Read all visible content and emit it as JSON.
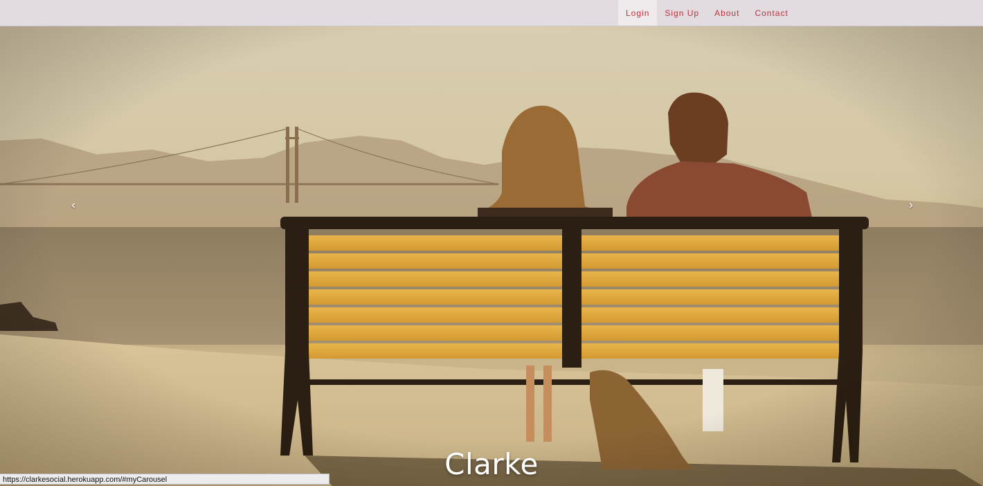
{
  "nav": {
    "items": [
      {
        "label": "Login",
        "active": true
      },
      {
        "label": "Sign Up",
        "active": false
      },
      {
        "label": "About",
        "active": false
      },
      {
        "label": "Contact",
        "active": false
      }
    ]
  },
  "carousel": {
    "prev_icon": "chevron-left-icon",
    "next_icon": "chevron-right-icon",
    "prev_glyph": "‹",
    "next_glyph": "›",
    "caption": "Clarke"
  },
  "status_bar": {
    "url": "https://clarkesocial.herokuapp.com/#myCarousel"
  },
  "colors": {
    "navbar_bg": "#e2dce0",
    "nav_link": "#b8323a",
    "active_bg": "#efeaec"
  }
}
